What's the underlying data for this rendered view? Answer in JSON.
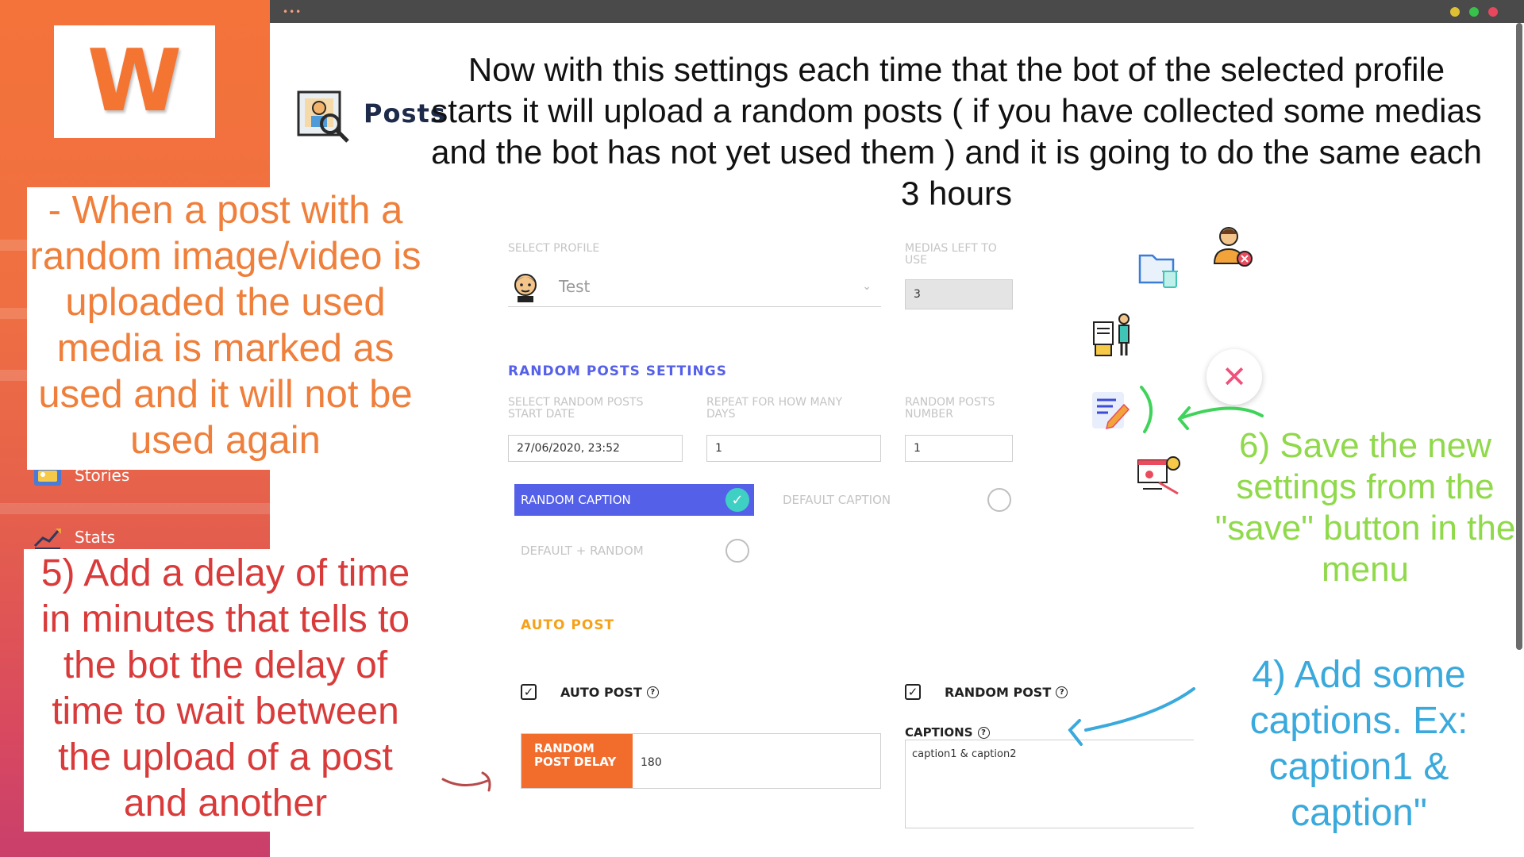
{
  "app": {
    "logo_letter": "W",
    "page_title": "Posts",
    "window_dots": "•••"
  },
  "colors": {
    "brand_orange": "#f47432",
    "accent_blue": "#5560e8",
    "teal_check": "#3fd0c4",
    "auto_post_orange": "#f5a21a",
    "close_pink": "#f0507a"
  },
  "sidebar": {
    "items": [
      {
        "label": "Stories",
        "icon": "stories-icon"
      },
      {
        "label": "Stats",
        "icon": "stats-icon"
      }
    ]
  },
  "form": {
    "select_profile_label": "SELECT PROFILE",
    "profile_name": "Test",
    "medias_left_label": "MEDIAS LEFT TO USE",
    "medias_left_value": "3",
    "random_posts_title": "RANDOM POSTS SETTINGS",
    "start_date_label": "SELECT RANDOM POSTS START DATE",
    "start_date_value": "27/06/2020, 23:52",
    "repeat_days_label": "REPEAT FOR HOW MANY DAYS",
    "repeat_days_value": "1",
    "posts_number_label": "RANDOM POSTS NUMBER",
    "posts_number_value": "1",
    "caption_options": [
      {
        "label": "RANDOM CAPTION",
        "selected": true
      },
      {
        "label": "DEFAULT CAPTION",
        "selected": false
      },
      {
        "label": "DEFAULT + RANDOM",
        "selected": false
      }
    ],
    "auto_post_title": "AUTO POST",
    "auto_post_label": "AUTO POST",
    "auto_post_checked": true,
    "random_post_label": "RANDOM POST",
    "random_post_checked": true,
    "delay_label": "RANDOM POST DELAY",
    "delay_value": "180",
    "captions_label": "CAPTIONS",
    "captions_value": "caption1 & caption2"
  },
  "menu": {
    "close_symbol": "✕",
    "icons": [
      "folder-trash-icon",
      "user-remove-icon",
      "document-person-icon",
      "edit-note-icon",
      "presentation-idea-icon"
    ]
  },
  "annotations": {
    "top": "Now with this settings each time that the bot of the selected profile starts it will upload a random posts ( if you have collected some medias and the bot has not yet used them ) and it is going to do the same each 3 hours",
    "orange": "- When a post with a random image/video is uploaded the used media is marked as used and it will not be used again",
    "red": "5) Add a delay of time in minutes that tells to the bot the delay of time to wait between the upload of a post and another",
    "green": "6) Save the new settings from the \"save\" button in the menu",
    "blue": "4) Add some captions. Ex: caption1 & caption\""
  }
}
